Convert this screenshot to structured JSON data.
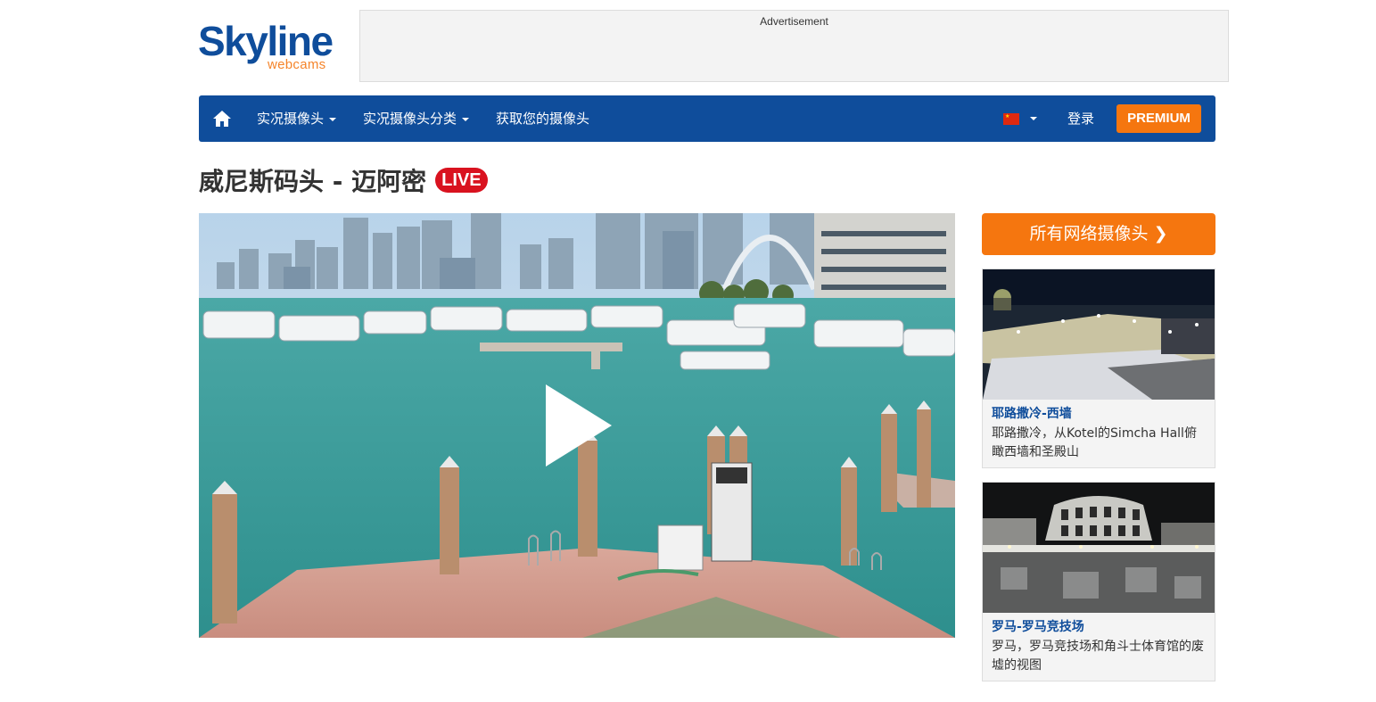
{
  "logo": {
    "main": "Skyline",
    "sub": "webcams"
  },
  "ad": {
    "label": "Advertisement"
  },
  "nav": {
    "items": [
      {
        "label": "实况摄像头"
      },
      {
        "label": "实况摄像头分类"
      },
      {
        "label": "获取您的摄像头"
      }
    ],
    "login": "登录",
    "premium": "PREMIUM"
  },
  "page": {
    "title": "威尼斯码头 - 迈阿密",
    "live": "LIVE"
  },
  "sidebar": {
    "all_cams": "所有网络摄像头",
    "cards": [
      {
        "title": "耶路撒冷-西墙",
        "desc": "耶路撒冷，从Kotel的Simcha Hall俯瞰西墙和圣殿山"
      },
      {
        "title": "罗马-罗马竞技场",
        "desc": "罗马，罗马竞技场和角斗士体育馆的废墟的视图"
      }
    ]
  },
  "colors": {
    "brand_blue": "#0f4d9b",
    "accent_orange": "#f5760f",
    "live_red": "#d9121f"
  }
}
